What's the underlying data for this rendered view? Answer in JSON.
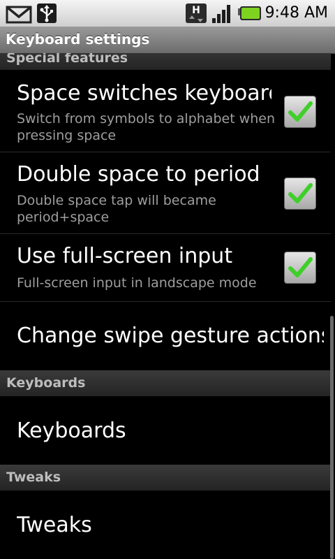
{
  "status_bar": {
    "time": "9:48 AM",
    "icons": [
      "gmail-icon",
      "usb-icon",
      "hspa-data-icon",
      "signal-icon",
      "battery-icon"
    ],
    "battery_color": "#7ed321"
  },
  "title_bar": {
    "title": "Keyboard settings"
  },
  "sections": {
    "special_features": {
      "header": "Special features"
    },
    "keyboards": {
      "header": "Keyboards"
    },
    "tweaks": {
      "header": "Tweaks"
    }
  },
  "items": {
    "space_switches": {
      "title": "Space switches keyboard",
      "summary": "Switch from symbols to alphabet when pressing space",
      "checked": true
    },
    "double_space": {
      "title": "Double space to period",
      "summary": "Double space tap will became period+space",
      "checked": true
    },
    "fullscreen": {
      "title": "Use full-screen input",
      "summary": "Full-screen input in landscape mode",
      "checked": true
    },
    "swipe": {
      "title": "Change swipe gesture actions"
    },
    "keyboards": {
      "title": "Keyboards"
    },
    "tweaks": {
      "title": "Tweaks"
    }
  },
  "colors": {
    "background": "#000000",
    "check_green": "#3fcf2a",
    "summary_text": "#9e9e9e"
  }
}
